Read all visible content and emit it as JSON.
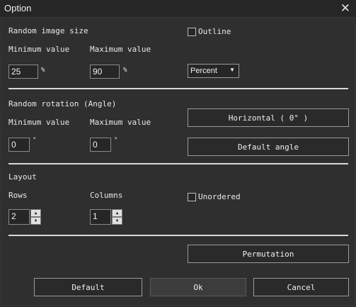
{
  "window": {
    "title": "Option",
    "close_label": "✕"
  },
  "size": {
    "heading": "Random image size",
    "min_label": "Minimum value",
    "max_label": "Maximum value",
    "min_value": "25",
    "max_value": "90",
    "unit": "%",
    "outline_label": "Outline",
    "mode_selected": "Percent"
  },
  "rotation": {
    "heading": "Random rotation (Angle)",
    "min_label": "Minimum value",
    "max_label": "Maximum value",
    "min_value": "0",
    "max_value": "0",
    "unit": "°",
    "horizontal_button": "Horizontal ( 0° )",
    "default_angle_button": "Default angle"
  },
  "layout": {
    "heading": "Layout",
    "rows_label": "Rows",
    "columns_label": "Columns",
    "rows_value": "2",
    "columns_value": "1",
    "unordered_label": "Unordered"
  },
  "footer": {
    "permutation_button": "Permutation",
    "default_button": "Default",
    "ok_button": "Ok",
    "cancel_button": "Cancel"
  }
}
